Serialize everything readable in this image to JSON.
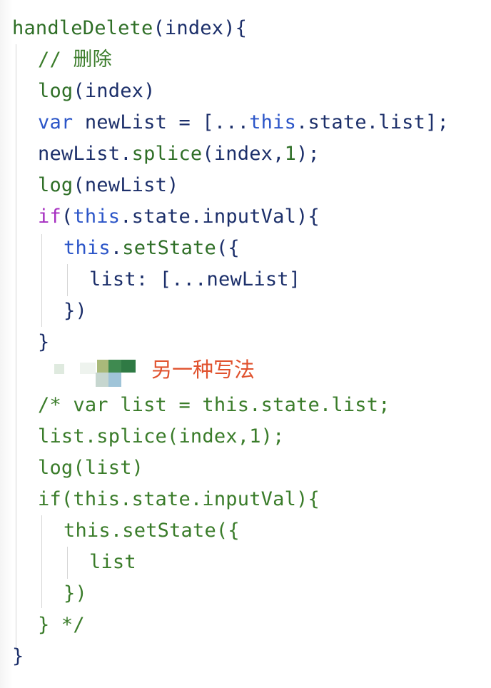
{
  "code": {
    "l1_fn": "handleDelete",
    "l1_rest": "(index){",
    "l2": "// 删除",
    "l3_fn": "log",
    "l3_rest": "(index)",
    "l4_var": "var",
    "l4_name": " newList = [...",
    "l4_this": "this",
    "l4_rest": ".state.list];",
    "l5_id": "newList.",
    "l5_fn": "splice",
    "l5_mid": "(index,",
    "l5_num": "1",
    "l5_end": ");",
    "l6_fn": "log",
    "l6_rest": "(newList)",
    "l7_if": "if",
    "l7_p1": "(",
    "l7_this": "this",
    "l7_rest": ".state.inputVal){",
    "l8_this": "this",
    "l8_dot": ".",
    "l8_fn": "setState",
    "l8_rest": "({",
    "l9": "list: [...newList]",
    "l10": "})",
    "l11": "}",
    "c1": "/* var list = this.state.list;",
    "c2": "list.splice(index,1);",
    "c3": "log(list)",
    "c4": "if(this.state.inputVal){",
    "c5": "this.setState({",
    "c6": "list",
    "c7": "})",
    "c8": "} */",
    "end": "}"
  },
  "annotation": {
    "text": "另一种写法",
    "color": "#e0522e"
  },
  "colors": {
    "keyword": "#a62fc1",
    "this": "#2b55c8",
    "function": "#2f6f27",
    "identifier": "#1c2f6a",
    "comment": "#3a7c2a"
  }
}
